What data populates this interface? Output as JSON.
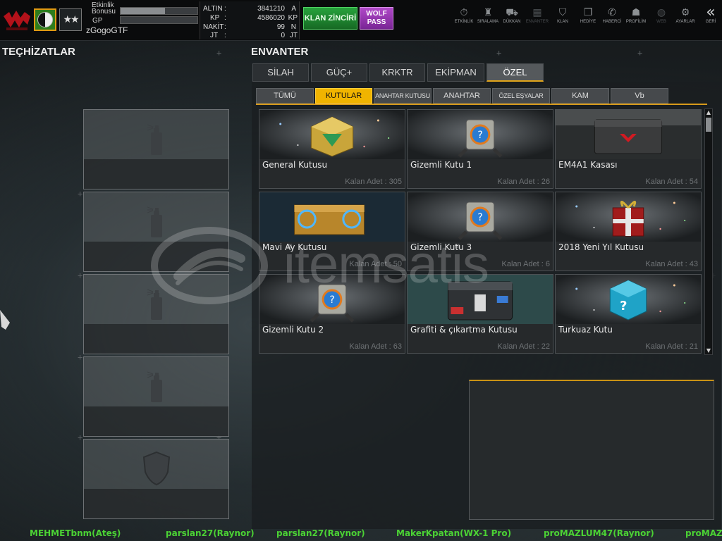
{
  "header": {
    "bonus_label": "Etkinlik\nBonusu",
    "bonus_fill_fraction": 0.58,
    "gp_label": "GP",
    "gp_fill_fraction": 0.0,
    "username": "zGogoGTF",
    "currency": [
      {
        "label": "ALTIN",
        "value": "3841210",
        "unit": "A"
      },
      {
        "label": "KP",
        "value": "4586020",
        "unit": "KP"
      },
      {
        "label": "NAKİT",
        "value": "99",
        "unit": "N"
      },
      {
        "label": "JT",
        "value": "0",
        "unit": "JT"
      }
    ],
    "klan_button": "KLAN ZİNCİRİ",
    "wolf_button": "WOLF PASS",
    "nav": [
      {
        "label": "ETKİNLİK",
        "icon": "stopwatch-icon",
        "glyph": "⏱"
      },
      {
        "label": "SIRALAMA",
        "icon": "medal-icon",
        "glyph": "♜"
      },
      {
        "label": "DÜKKAN",
        "icon": "cart-icon",
        "glyph": "⛟"
      },
      {
        "label": "ENVANTER",
        "icon": "inventory-icon",
        "glyph": "▦"
      },
      {
        "label": "KLAN",
        "icon": "shield-icon",
        "glyph": "⛉"
      },
      {
        "label": "HEDİYE",
        "icon": "gift-icon",
        "glyph": "❒"
      },
      {
        "label": "HABERCİ",
        "icon": "megaphone-icon",
        "glyph": "✆"
      },
      {
        "label": "PROFİLİM",
        "icon": "profile-icon",
        "glyph": "☗"
      },
      {
        "label": "WEB",
        "icon": "globe-icon",
        "glyph": "◍"
      },
      {
        "label": "AYARLAR",
        "icon": "gear-icon",
        "glyph": "⚙"
      },
      {
        "label": "GERİ",
        "icon": "back-chevrons-icon",
        "glyph": "«"
      }
    ]
  },
  "equipment": {
    "title": "TEÇHİZATLAR",
    "slots": [
      {
        "icon": "spray-can-icon"
      },
      {
        "icon": "spray-can-icon"
      },
      {
        "icon": "spray-can-icon"
      },
      {
        "icon": "spray-can-icon"
      },
      {
        "icon": "shield-icon"
      }
    ]
  },
  "inventory": {
    "title": "ENVANTER",
    "tabs": [
      "SİLAH",
      "GÜÇ+",
      "KRKTR",
      "EKİPMAN",
      "ÖZEL"
    ],
    "active_tab": "ÖZEL",
    "subtabs": [
      "TÜMÜ",
      "KUTULAR",
      "ANAHTAR KUTUSU",
      "ANAHTAR",
      "ÖZEL EŞYALAR",
      "KAM",
      "Vb"
    ],
    "active_subtab": "KUTULAR",
    "items": [
      {
        "name": "General Kutusu",
        "count": "Kalan Adet : 305",
        "icon": "general-box-icon"
      },
      {
        "name": "Gizemli Kutu 1",
        "count": "Kalan Adet : 26",
        "icon": "mystery-box-icon"
      },
      {
        "name": "EM4A1 Kasası",
        "count": "Kalan Adet : 54",
        "icon": "weapon-case-icon"
      },
      {
        "name": "Mavi Ay Kutusu",
        "count": "Kalan Adet : 50",
        "icon": "blue-moon-box-icon"
      },
      {
        "name": "Gizemli Kutu 3",
        "count": "Kalan Adet : 6",
        "icon": "mystery-box-icon"
      },
      {
        "name": "2018 Yeni Yıl Kutusu",
        "count": "Kalan Adet : 43",
        "icon": "gift-box-icon"
      },
      {
        "name": "Gizemli Kutu 2",
        "count": "Kalan Adet : 63",
        "icon": "mystery-box-icon"
      },
      {
        "name": "Grafiti & çıkartma Kutusu",
        "count": "Kalan Adet : 22",
        "icon": "graffiti-case-icon"
      },
      {
        "name": "Turkuaz Kutu",
        "count": "Kalan Adet : 21",
        "icon": "turquoise-question-box-icon"
      }
    ]
  },
  "watermark": {
    "text": "itemsatis"
  },
  "ticker": [
    "MEHMETbnm(Ateş)",
    "parslan27(Raynor)",
    "parslan27(Raynor)",
    "MakerKpatan(WX-1 Pro)",
    "proMAZLUM47(Raynor)",
    "proMAZ"
  ]
}
